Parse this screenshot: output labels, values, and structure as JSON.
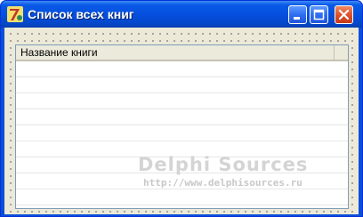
{
  "window": {
    "title": "Список всех книг",
    "controls": [
      "minimize-icon",
      "maximize-icon",
      "close-icon"
    ],
    "colors": {
      "titlebar": "#0650df",
      "client": "#ece9d8",
      "close": "#e0532b"
    }
  },
  "listview": {
    "columns": [
      {
        "label": "Название книги"
      }
    ],
    "rows": []
  },
  "watermark": {
    "title": "Delphi Sources",
    "url": "http://www.delphisources.ru"
  }
}
